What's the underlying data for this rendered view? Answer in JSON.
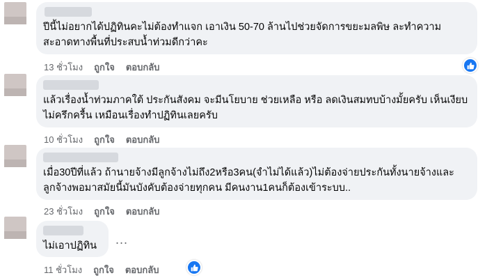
{
  "comments": [
    {
      "text": "ปีนี้ไม่อยากได้ปฏิทินคะไม่ต้องทำแจก เอาเงิน 50-70 ล้านไปช่วยจัดการขยะมลพิษ ละทำความสะอาดทางพื้นที่ประสบน้ำท่วมดีกว่าคะ",
      "time": "13 ชั่วโมง",
      "like": "ถูกใจ",
      "reply": "ตอบกลับ",
      "reaction_icon": "like-icon"
    },
    {
      "text": "แล้วเรื่องน้ำท่วมภาคใต้ ประกันสังคม จะมีนโยบาย ช่วยเหลือ หรือ ลดเงินสมทบบ้างมั้ยครับ เห็นเงียบ ไม่ครึกครื้น เหมือนเรื่องทำปฏิทินเลยครับ",
      "time": "10 ชั่วโมง",
      "like": "ถูกใจ",
      "reply": "ตอบกลับ"
    },
    {
      "text": "เมื่อ30ปีที่แล้ว ถ้านายจ้างมีลูกจ้างไม่ถึง2หรือ3คน(จำไม่ได้แล้ว)ไม่ต้องจ่ายประกันทั้งนายจ้างและลูกจ้างพอมาสมัยนี้มันบังคับต้องจ่ายทุกคน มีคนงาน1คนก็ต้องเข้าระบบ..",
      "time": "23 ชั่วโมง",
      "like": "ถูกใจ",
      "reply": "ตอบกลับ"
    },
    {
      "text": "ไม่เอาปฏิทิน",
      "time": "11 ชั่วโมง",
      "like": "ถูกใจ",
      "reply": "ตอบกลับ",
      "reaction_icon": "like-icon"
    }
  ],
  "more_options": "...",
  "colors": {
    "bubble": "#f0f2f5",
    "meta_text": "#65676b",
    "like_blue": "#1877f2"
  }
}
